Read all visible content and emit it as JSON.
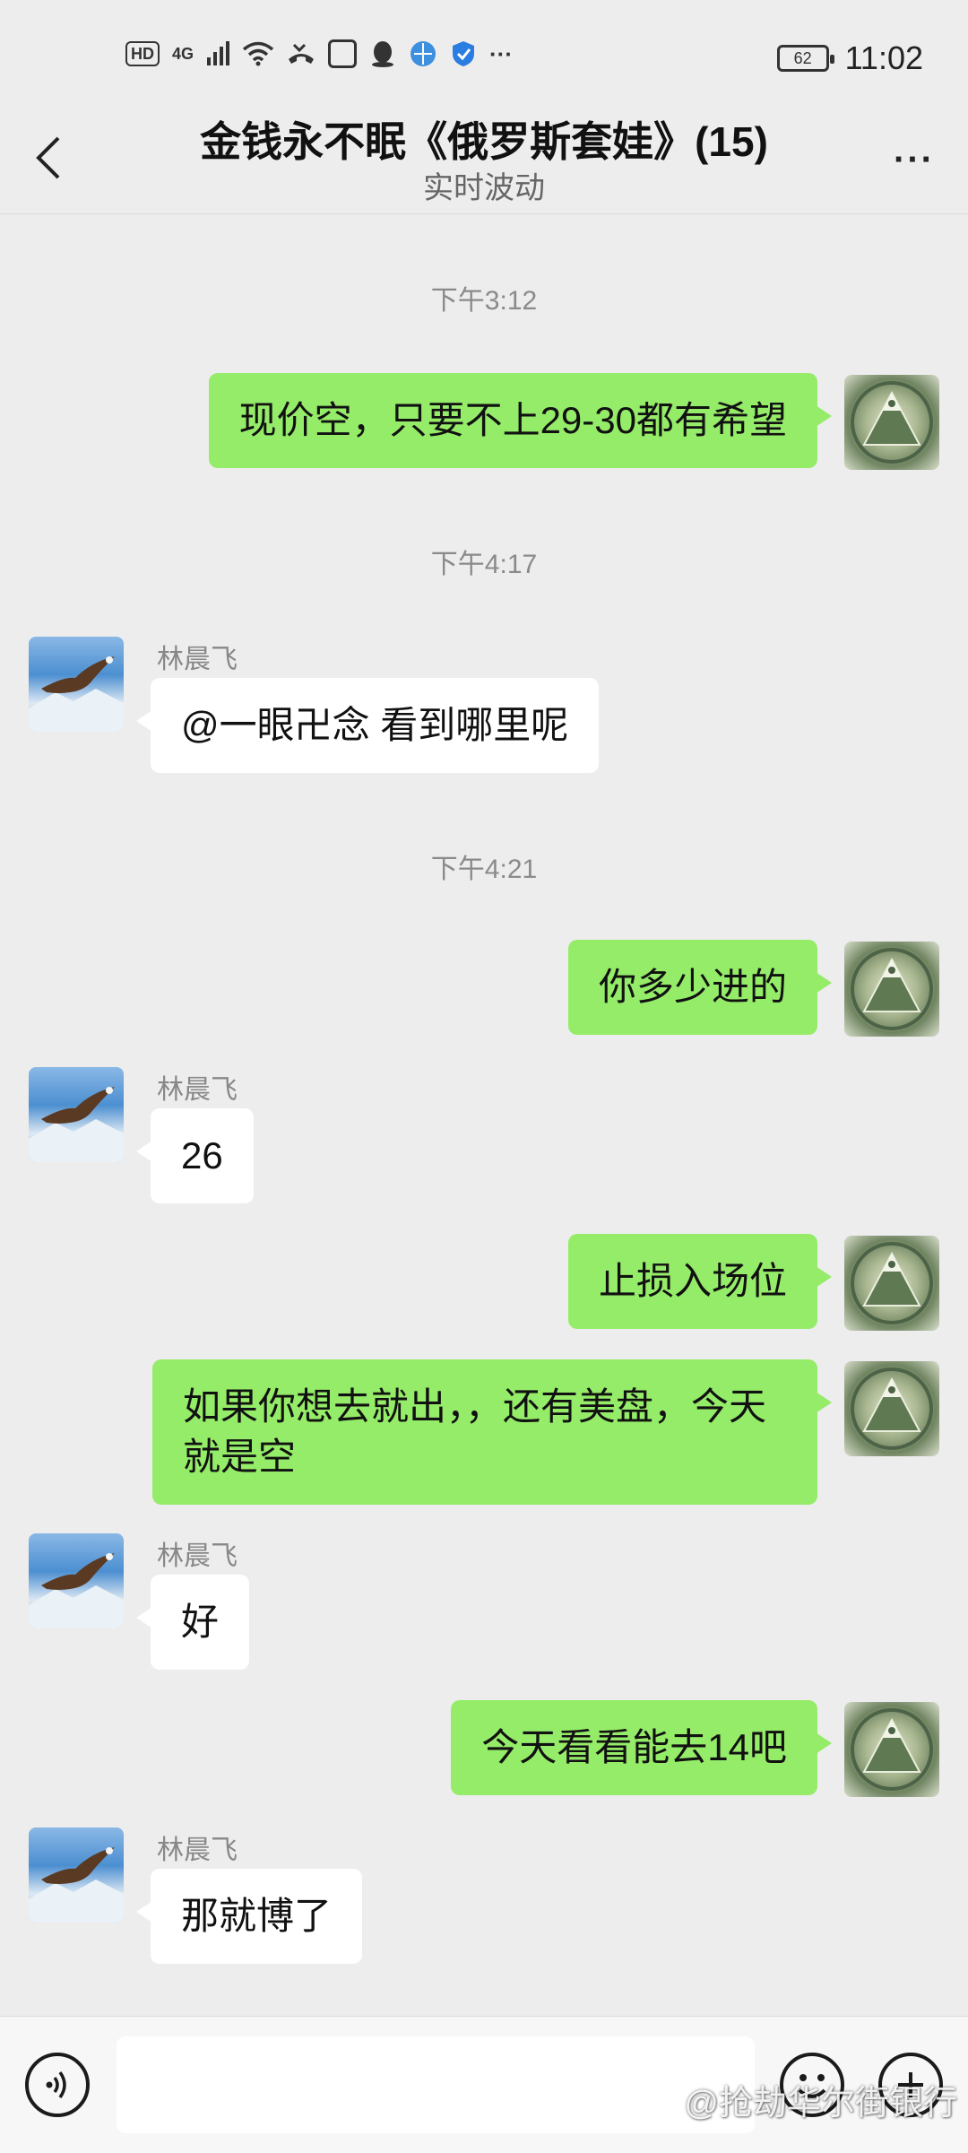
{
  "status_bar": {
    "hd": "HD",
    "network": "4G",
    "more": "···",
    "battery": "62",
    "time": "11:02"
  },
  "header": {
    "title": "金钱永不眠《俄罗斯套娃》(15)",
    "subtitle": "实时波动",
    "more": "···"
  },
  "messages": [
    {
      "type": "time",
      "text": "下午3:12"
    },
    {
      "type": "msg",
      "side": "me",
      "text": "现价空，只要不上29-30都有希望"
    },
    {
      "type": "time",
      "text": "下午4:17"
    },
    {
      "type": "msg",
      "side": "other",
      "sender": "林晨飞",
      "text": "@一眼卍念  看到哪里呢"
    },
    {
      "type": "time",
      "text": "下午4:21"
    },
    {
      "type": "msg",
      "side": "me",
      "text": "你多少进的"
    },
    {
      "type": "msg",
      "side": "other",
      "sender": "林晨飞",
      "text": "26"
    },
    {
      "type": "msg",
      "side": "me",
      "text": "止损入场位"
    },
    {
      "type": "msg",
      "side": "me",
      "text": "如果你想去就出，，还有美盘，今天就是空"
    },
    {
      "type": "msg",
      "side": "other",
      "sender": "林晨飞",
      "text": "好"
    },
    {
      "type": "msg",
      "side": "me",
      "text": "今天看看能去14吧"
    },
    {
      "type": "msg",
      "side": "other",
      "sender": "林晨飞",
      "text": "那就博了"
    }
  ],
  "input_bar": {
    "watermark": "@抢劫华尔街银行"
  },
  "colors": {
    "background": "#ededed",
    "my_bubble": "#95ec69",
    "other_bubble": "#ffffff"
  },
  "icons": [
    "voice-icon",
    "emoji-icon",
    "plus-icon",
    "back-icon",
    "more-icon"
  ]
}
